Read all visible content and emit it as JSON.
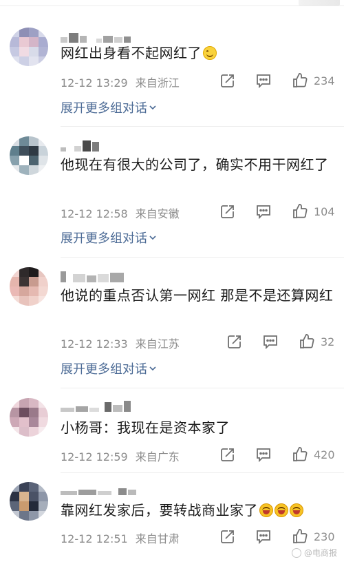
{
  "comments": [
    {
      "text": "网红出身看不起网红了",
      "emoji": "smile-emoji",
      "time": "12-12 13:29",
      "location": "来自浙江",
      "likes": "234",
      "expand": "展开更多组对话"
    },
    {
      "text": "他现在有很大的公司了，确实不用干网红了",
      "time": "12-12 12:58",
      "location": "来自安徽",
      "likes": "104",
      "expand": "展开更多组对话"
    },
    {
      "text": "他说的重点否认第一网红 那是不是还算网红",
      "time": "12-12 12:33",
      "location": "来自江苏",
      "likes": "32",
      "expand": "展开更多组对话"
    },
    {
      "text": "小杨哥：我现在是资本家了",
      "time": "12-12 12:59",
      "location": "来自广东",
      "likes": "420"
    },
    {
      "text": "靠网红发家后，要转战商业家了",
      "emoji": "laughing-emoji",
      "time": "12-12 12:51",
      "location": "来自甘肃",
      "likes": "230"
    }
  ],
  "icons": {
    "repost": "repost-icon",
    "comment": "comment-icon",
    "like": "thumbs-up-icon",
    "expand": "chevron-down-icon"
  },
  "watermark": "@电商报",
  "colors": {
    "link": "#4b6a95",
    "meta": "#8c8c8c",
    "text": "#1b1b1b"
  }
}
